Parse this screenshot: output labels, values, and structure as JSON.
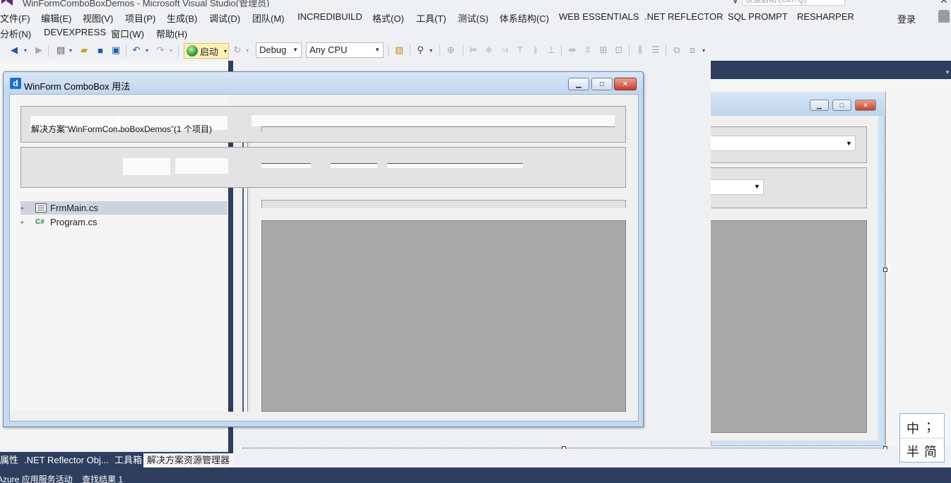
{
  "window": {
    "title": "WinFormComboBoxDemos - Microsoft Visual Studio(管理员)",
    "quick_launch_placeholder": "快速启动 (Ctrl+Q)",
    "user_label": "登录"
  },
  "menu": {
    "row1": [
      "文件(F)",
      "编辑(E)",
      "视图(V)",
      "项目(P)",
      "生成(B)",
      "调试(D)",
      "团队(M)",
      "INCREDIBUILD",
      "格式(O)",
      "工具(T)",
      "测试(S)",
      "体系结构(C)",
      "WEB ESSENTIALS",
      ".NET REFLECTOR",
      "SQL PROMPT",
      "RESHARPER"
    ],
    "row2": [
      "分析(N)",
      "DEVEXPRESS",
      "窗口(W)",
      "帮助(H)"
    ]
  },
  "toolbar": {
    "start_label": "启动",
    "config_value": "Debug",
    "platform_value": "Any CPU"
  },
  "app_window": {
    "title": "WinForm ComboBox 用法",
    "icon_glyph": "d"
  },
  "solution_explorer": {
    "header": "解决方案“WinFormComboBoxDemos”(1 个项目)",
    "items": [
      {
        "label": "FrmMain.cs",
        "icon": "form-file-icon"
      },
      {
        "label": "Program.cs",
        "icon": "csharp-file-icon"
      }
    ]
  },
  "bottom_tabs": [
    "属性",
    ".NET Reflector Obj...",
    "工具箱",
    "解决方案资源管理器"
  ],
  "status_bar": [
    "Azure 应用服务活动",
    "查找结果 1"
  ],
  "ime": {
    "chinese": "中",
    "punct": "；",
    "half_width": "半",
    "simplified": "简"
  }
}
